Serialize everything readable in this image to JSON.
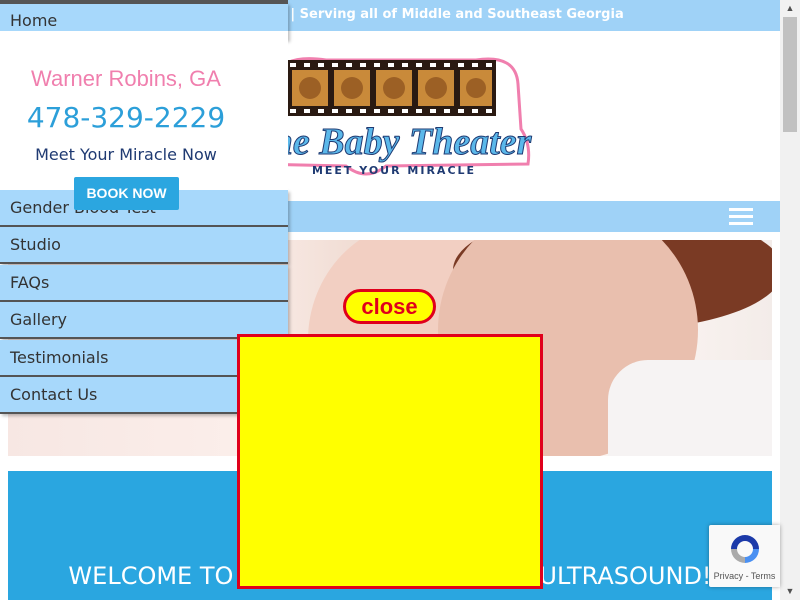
{
  "topbar": {
    "text": "The Baby Theater | Serving all of Middle and Southeast Georgia"
  },
  "header": {
    "location": "Warner Robins, GA",
    "phone": "478-329-2229",
    "tagline": "Meet Your Miracle Now",
    "book_button": "BOOK NOW"
  },
  "logo": {
    "title": "The Baby Theater",
    "subtitle": "MEET YOUR MIRACLE"
  },
  "menu": {
    "items": [
      {
        "label": "Home"
      },
      {
        "label": "Gender Blood Test"
      },
      {
        "label": "Studio"
      },
      {
        "label": "FAQs"
      },
      {
        "label": "Gallery"
      },
      {
        "label": "Testimonials"
      },
      {
        "label": "Contact Us"
      }
    ]
  },
  "popup": {
    "close_label": "close"
  },
  "welcome": {
    "left_text": "WELCOME TO",
    "right_text": "ULTRASOUND!"
  },
  "recaptcha": {
    "text": "Privacy - Terms"
  },
  "icons": {
    "menu": "hamburger-icon",
    "recaptcha": "recaptcha-icon"
  },
  "colors": {
    "accent_blue": "#2aa6e0",
    "light_blue": "#9fd2f7",
    "pink": "#f07fae",
    "navy": "#1f3a72",
    "popup_yellow": "#ffff00",
    "popup_red": "#e0001b"
  }
}
